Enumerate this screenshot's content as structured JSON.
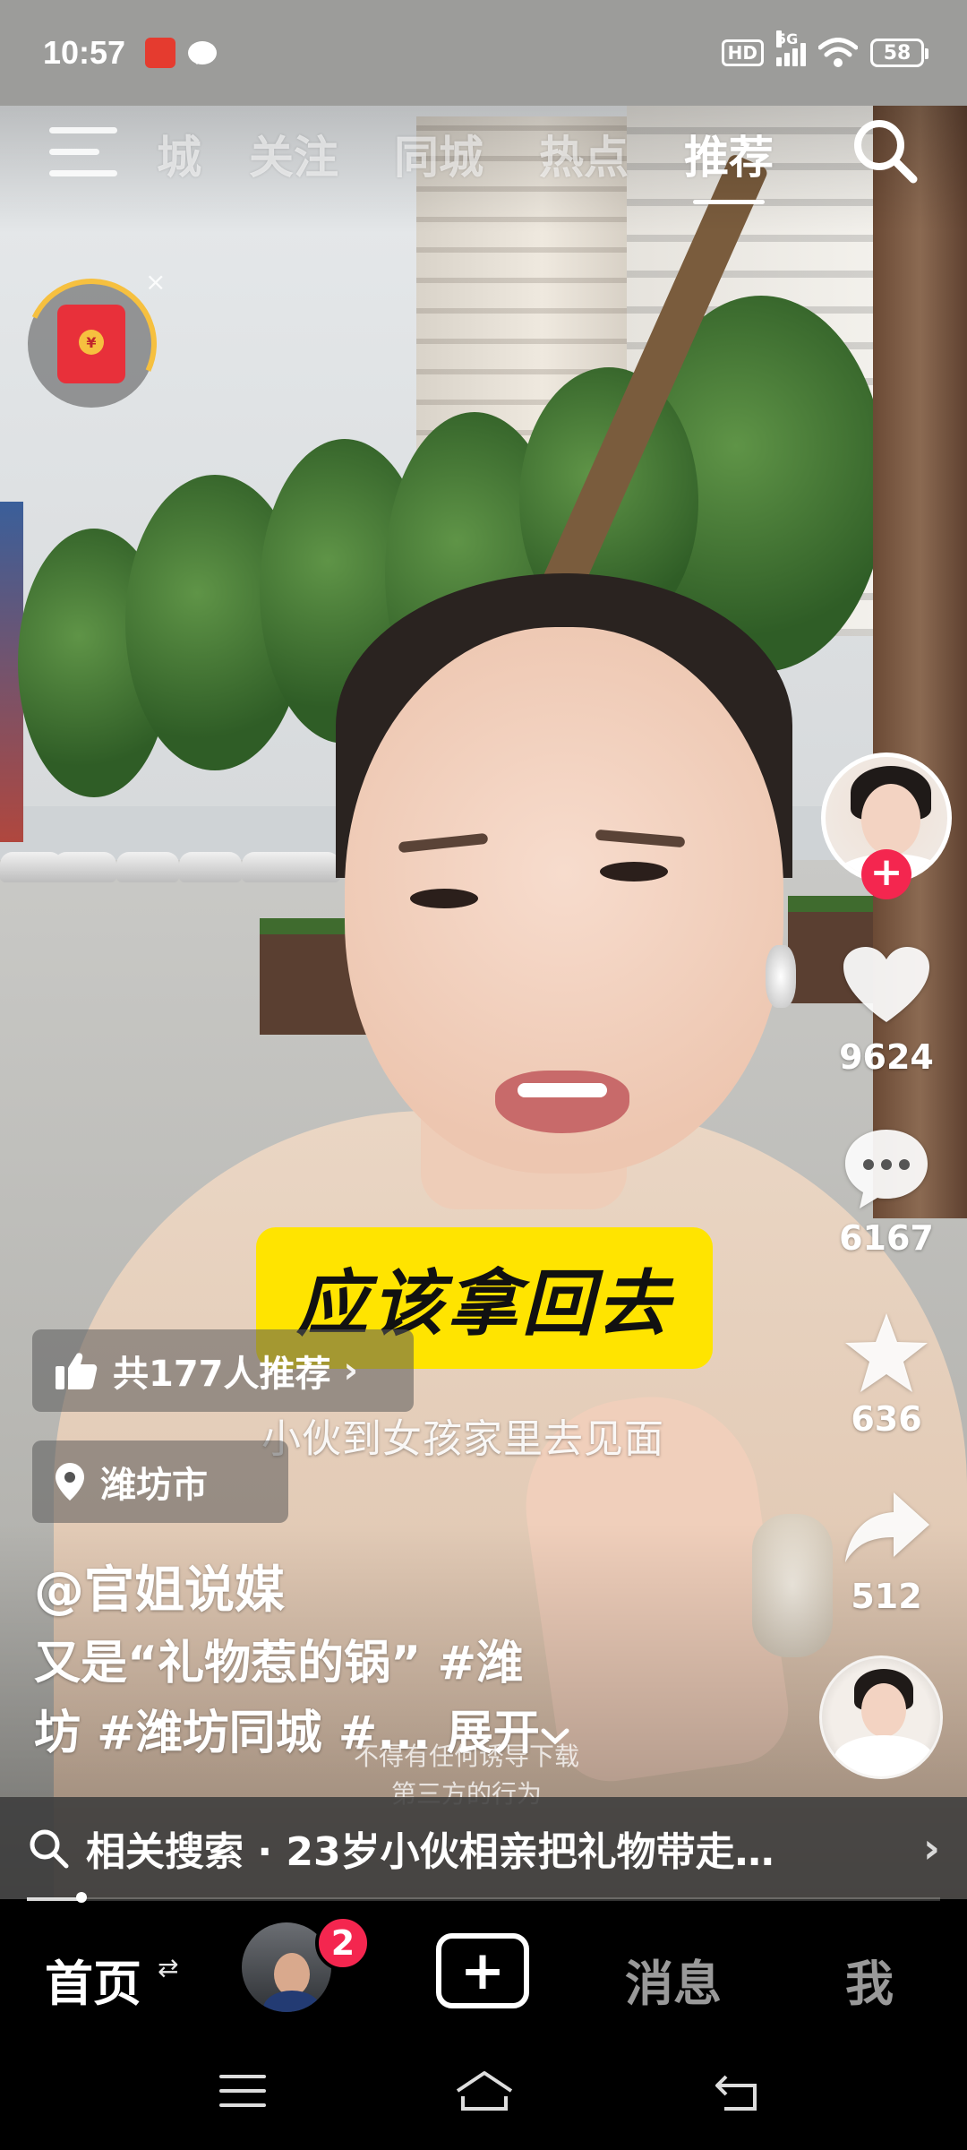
{
  "status_bar": {
    "time": "10:57",
    "hd": "HD",
    "network": "5G",
    "battery": "58"
  },
  "top_nav": {
    "tabs": [
      {
        "label": "城",
        "active": false
      },
      {
        "label": "关注",
        "active": false
      },
      {
        "label": "同城",
        "active": false
      },
      {
        "label": "热点",
        "active": false
      },
      {
        "label": "推荐",
        "active": true
      }
    ]
  },
  "red_packet": {
    "coin": "¥",
    "close": "×"
  },
  "right_rail": {
    "likes": "9624",
    "comments": "6167",
    "favorites": "636",
    "shares": "512"
  },
  "video": {
    "yellow_caption": "应该拿回去",
    "subtitle": "小伙到女孩家里去见面",
    "recommend_pill": "共177人推荐",
    "location_pill": "潍坊市",
    "author": "@官姐说媒",
    "description_line1": "又是“礼物惹的锅” #潍",
    "description_line2": "坊 #潍坊同城 #...",
    "expand_label": "展开",
    "disclaimer_line1": "不得有任何诱导下载",
    "disclaimer_line2": "第三方的行为"
  },
  "related_search": {
    "text": "相关搜索 · 23岁小伙相亲把礼物带走…",
    "progress": 0.06
  },
  "bottom_nav": {
    "home": "首页",
    "badge": "2",
    "plus": "+",
    "messages": "消息",
    "me": "我"
  },
  "colors": {
    "accent_red": "#f4264f",
    "caption_yellow": "#ffe400"
  }
}
